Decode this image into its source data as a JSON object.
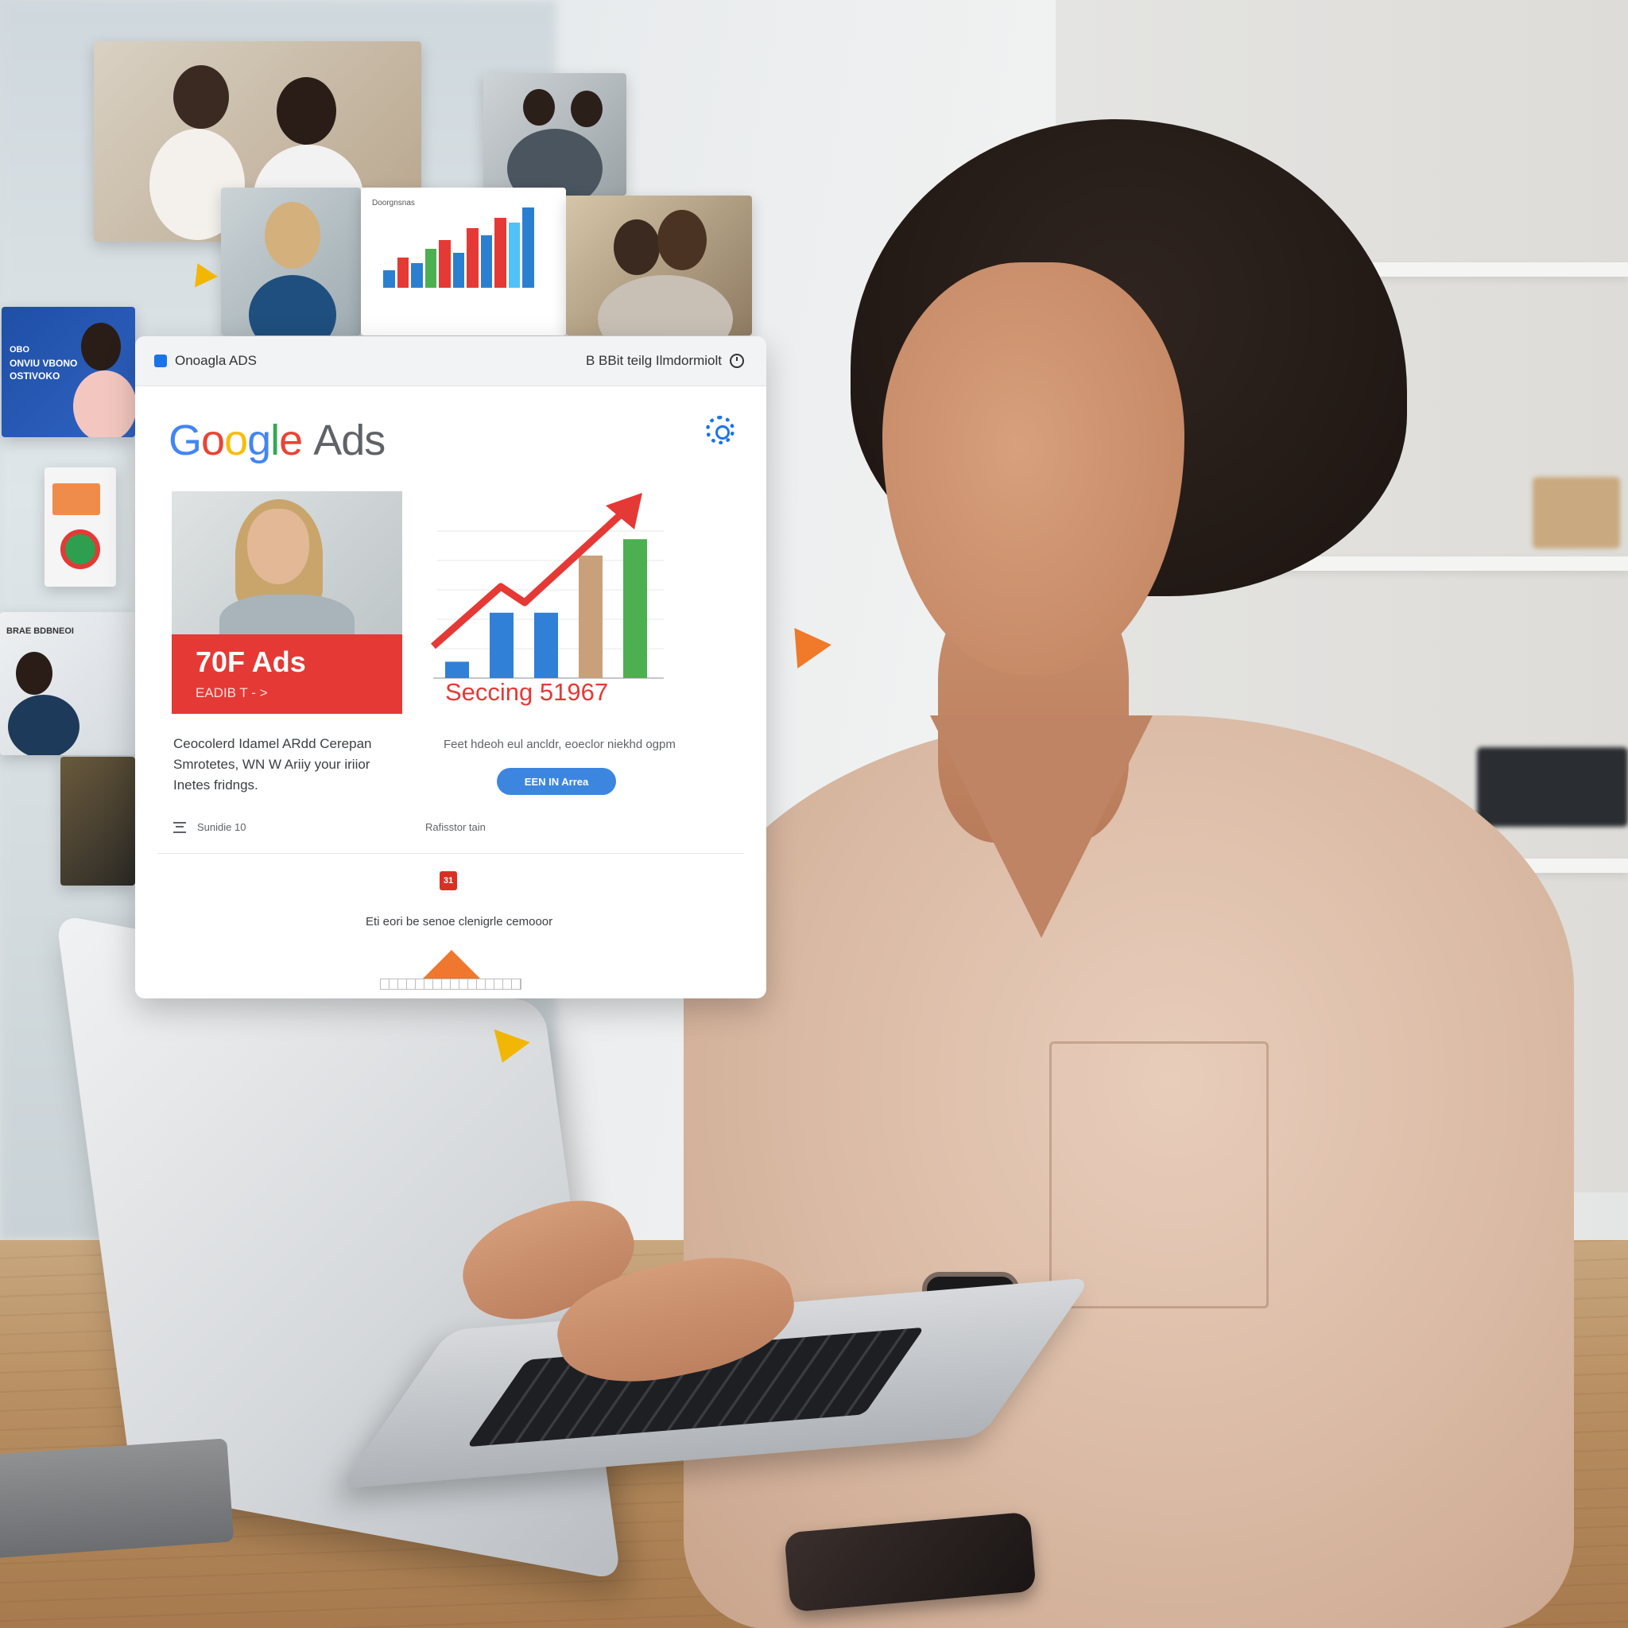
{
  "window": {
    "title": "Onoagla ADS",
    "status_text": "B  BBit teilg Ilmdormiolt"
  },
  "brand": {
    "google_letters": [
      "G",
      "o",
      "o",
      "g",
      "l",
      "e"
    ],
    "ads_word": "Ads"
  },
  "ad_card": {
    "headline": "70F Ads",
    "subline": "EADIB T - >"
  },
  "performance": {
    "title": "Seccing 51967",
    "chart_data": {
      "type": "bar",
      "values": [
        1,
        4,
        4,
        7.5,
        8.5
      ],
      "trend": "rising",
      "colors": [
        "#2f80d6",
        "#2f80d6",
        "#2f80d6",
        "#c9a07c",
        "#4caf50"
      ],
      "arrow_color": "#e53935"
    }
  },
  "copy": {
    "left": "Ceocolerd Idamel ARdd Cerepan Smrotetes, WN W Ariiy your iriior Inetes fridngs.",
    "right": "Feet hdeoh eul ancldr, eoeclor niekhd ogpm"
  },
  "cta": {
    "label": "EEN IN Arrea"
  },
  "footer": {
    "left_label": "Sunidie 10",
    "middle_label": "Rafisstor tain",
    "calendar_number": "31",
    "note": "Eti eori be senoe clenigrle cemooor"
  },
  "tiles": {
    "chart_tile_title": "Doorgnsnas",
    "promo_tile_text": [
      "OBO",
      "ONVIU VBONO",
      "OSTIVOKO"
    ],
    "small_tile_text": "BRAE BDBNEOI"
  },
  "colors": {
    "red": "#e53935",
    "blue": "#1a73e8",
    "green": "#4caf50",
    "orange": "#f0772e"
  }
}
